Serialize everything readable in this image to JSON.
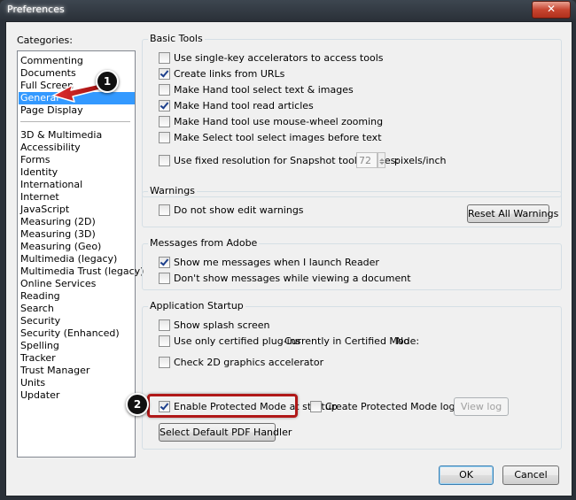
{
  "window": {
    "title": "Preferences",
    "close_glyph": "✕"
  },
  "categories": {
    "label": "Categories:",
    "items_top": [
      "Commenting",
      "Documents",
      "Full Screen",
      "General",
      "Page Display"
    ],
    "items_bottom": [
      "3D & Multimedia",
      "Accessibility",
      "Forms",
      "Identity",
      "International",
      "Internet",
      "JavaScript",
      "Measuring (2D)",
      "Measuring (3D)",
      "Measuring (Geo)",
      "Multimedia (legacy)",
      "Multimedia Trust (legacy)",
      "Online Services",
      "Reading",
      "Search",
      "Security",
      "Security (Enhanced)",
      "Spelling",
      "Tracker",
      "Trust Manager",
      "Units",
      "Updater"
    ],
    "selected": "General"
  },
  "basic_tools": {
    "title": "Basic Tools",
    "options": [
      {
        "label": "Use single-key accelerators to access tools",
        "checked": false
      },
      {
        "label": "Create links from URLs",
        "checked": true
      },
      {
        "label": "Make Hand tool select text & images",
        "checked": false
      },
      {
        "label": "Make Hand tool read articles",
        "checked": true
      },
      {
        "label": "Make Hand tool use mouse-wheel zooming",
        "checked": false
      },
      {
        "label": "Make Select tool select images before text",
        "checked": false
      }
    ],
    "snapshot": {
      "label": "Use fixed resolution for Snapshot tool images:",
      "checked": false,
      "value": "72",
      "unit": "pixels/inch"
    }
  },
  "warnings": {
    "title": "Warnings",
    "option": {
      "label": "Do not show edit warnings",
      "checked": false
    },
    "reset_button": "Reset All Warnings"
  },
  "messages": {
    "title": "Messages from Adobe",
    "options": [
      {
        "label": "Show me messages when I launch Reader",
        "checked": true
      },
      {
        "label": "Don't show messages while viewing a document",
        "checked": false
      }
    ]
  },
  "startup": {
    "title": "Application Startup",
    "splash": {
      "label": "Show splash screen",
      "checked": false
    },
    "certified": {
      "label": "Use only certified plug-ins",
      "checked": false
    },
    "certified_mode_label": "Currently in Certified Mode:",
    "certified_mode_value": "No",
    "gpu": {
      "label": "Check 2D graphics accelerator",
      "checked": false
    },
    "protected_mode": {
      "label": "Enable Protected Mode at startup",
      "checked": true
    },
    "protected_log": {
      "label": "Create Protected Mode log file",
      "checked": false
    },
    "view_log_button": "View log",
    "default_pdf_button": "Select Default PDF Handler"
  },
  "footer": {
    "ok": "OK",
    "cancel": "Cancel"
  },
  "annotations": {
    "step1": "1",
    "step2": "2"
  },
  "colors": {
    "selection": "#3399ff",
    "annotation": "#b01818"
  }
}
